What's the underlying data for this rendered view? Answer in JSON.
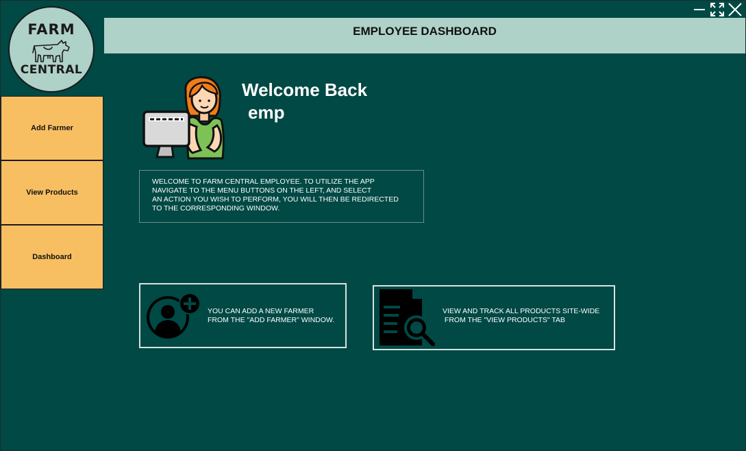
{
  "window": {
    "controls": [
      "minimize-icon",
      "maximize-icon",
      "close-icon"
    ]
  },
  "logo": {
    "line1": "FARM",
    "line2": "CENTRAL"
  },
  "sidebar": {
    "items": [
      {
        "label": "Add Farmer"
      },
      {
        "label": "View Products"
      },
      {
        "label": "Dashboard"
      }
    ]
  },
  "header": {
    "title": "EMPLOYEE DASHBOARD"
  },
  "welcome": {
    "greeting": "Welcome Back",
    "username": "emp"
  },
  "info": {
    "lines": [
      "WELCOME TO FARM CENTRAL EMPLOYEE. TO UTILIZE THE APP",
      "NAVIGATE TO THE MENU BUTTONS ON THE LEFT, AND SELECT",
      "AN ACTION YOU WISH TO PERFORM, YOU WILL THEN BE REDIRECTED",
      "TO THE CORRESPONDING WINDOW."
    ]
  },
  "cards": [
    {
      "icon": "add-user-icon",
      "lines": [
        "YOU CAN ADD A NEW FARMER",
        "FROM THE \"ADD FARMER\" WINDOW."
      ]
    },
    {
      "icon": "document-search-icon",
      "lines": [
        "VIEW AND TRACK ALL PRODUCTS SITE-WIDE",
        " FROM THE \"VIEW PRODUCTS\" TAB"
      ]
    }
  ],
  "colors": {
    "background": "#004945",
    "header": "#aed1c8",
    "sidebar_button": "#f8bf62",
    "text_light": "#ffffff"
  }
}
